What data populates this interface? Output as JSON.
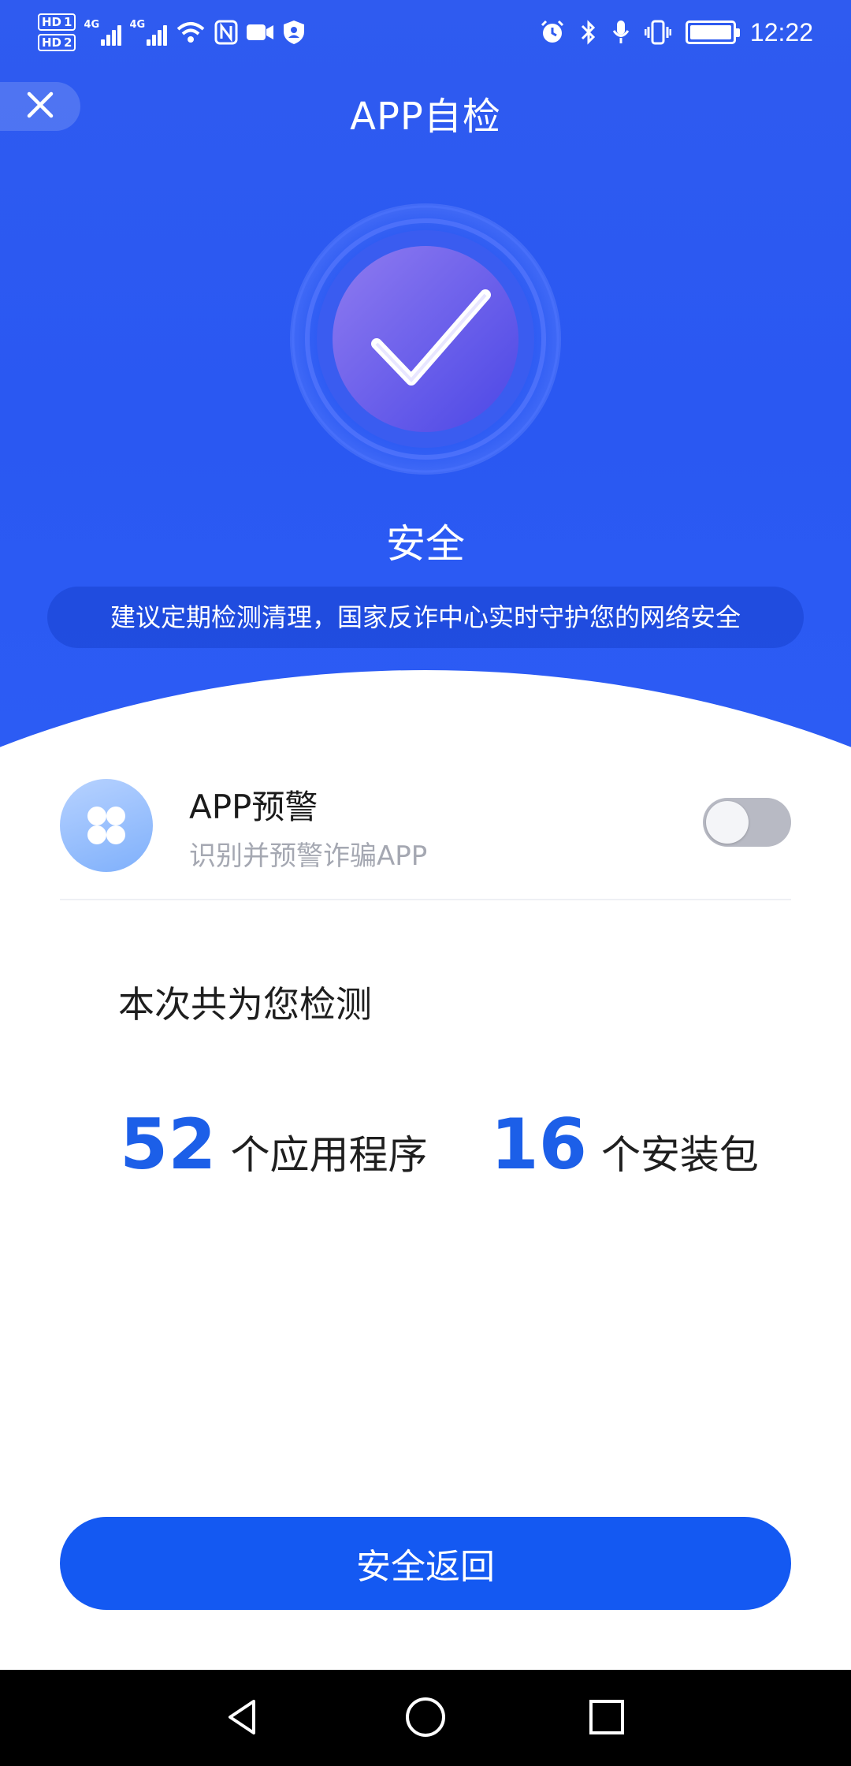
{
  "colors": {
    "hero_blue": "#2c5cf4",
    "accent_blue": "#1c5fe8",
    "button_blue": "#1459f2"
  },
  "status_bar": {
    "hd1": "HD",
    "hd1_sim": "1",
    "hd2": "HD",
    "hd2_sim": "2",
    "net1": "4G",
    "net2": "4G",
    "time": "12:22",
    "left_icons": [
      "signal-icon",
      "signal-icon",
      "wifi-icon",
      "nfc-icon",
      "video-icon",
      "shield-user-icon"
    ],
    "right_icons": [
      "alarm-icon",
      "bluetooth-icon",
      "microphone-icon",
      "vibrate-icon",
      "battery-charging-icon"
    ]
  },
  "nav": {
    "title": "APP自检",
    "close_icon": "close-icon"
  },
  "result": {
    "status": "安全",
    "tip": "建议定期检测清理，国家反诈中心实时守护您的网络安全"
  },
  "warning": {
    "title": "APP预警",
    "subtitle": "识别并预警诈骗APP",
    "toggle_on": false
  },
  "scan": {
    "caption": "本次共为您检测",
    "apps_count": "52",
    "apps_unit": "个应用程序",
    "packages_count": "16",
    "packages_unit": "个安装包"
  },
  "action": {
    "button_label": "安全返回"
  },
  "system_nav": [
    "back-icon",
    "home-icon",
    "recents-icon"
  ]
}
